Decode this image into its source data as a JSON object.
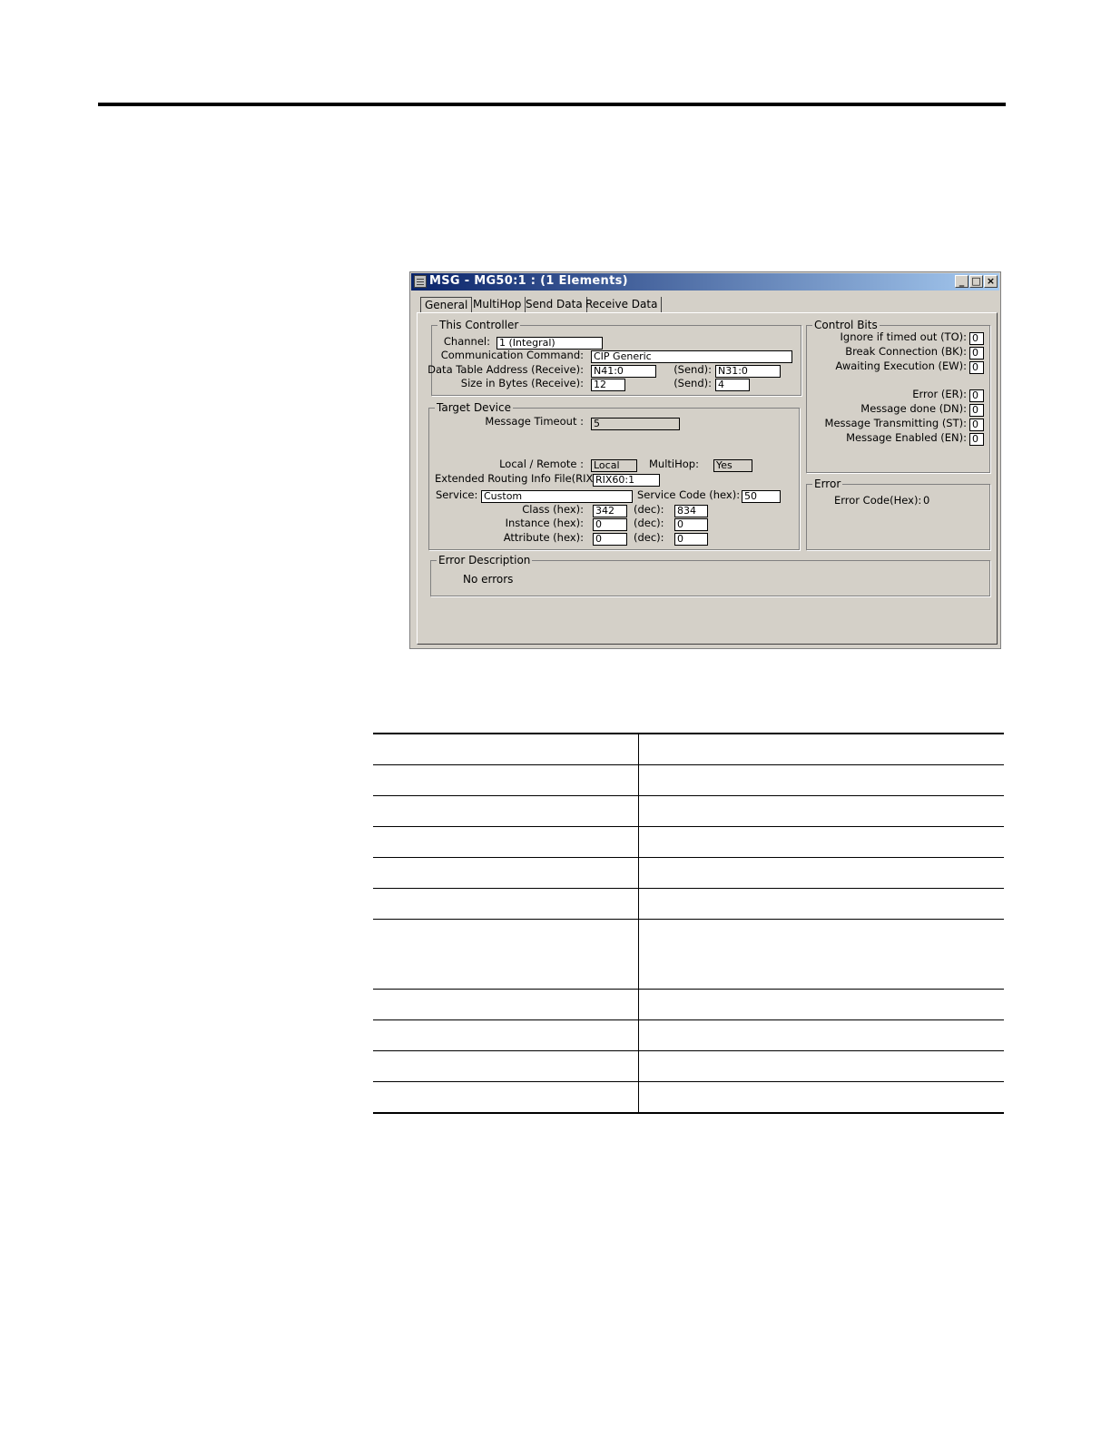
{
  "window": {
    "title": "MSG - MG50:1 : (1 Elements)",
    "min_glyph": "_",
    "max_glyph": "□",
    "close_glyph": "×"
  },
  "tabs": [
    {
      "label": "General",
      "active": true
    },
    {
      "label": "MultiHop",
      "active": false
    },
    {
      "label": "Send Data",
      "active": false
    },
    {
      "label": "Receive Data",
      "active": false
    }
  ],
  "this_controller": {
    "legend": "This Controller",
    "channel_label": "Channel:",
    "channel_value": "1 (Integral)",
    "command_label": "Communication Command:",
    "command_value": "CIP Generic",
    "dta_receive_label": "Data Table Address (Receive):",
    "dta_receive_value": "N41:0",
    "dta_send_label": "(Send):",
    "dta_send_value": "N31:0",
    "size_receive_label": "Size in Bytes (Receive):",
    "size_receive_value": "12",
    "size_send_label": "(Send):",
    "size_send_value": "4"
  },
  "target_device": {
    "legend": "Target Device",
    "timeout_label": "Message Timeout :",
    "timeout_value": "5",
    "local_remote_label": "Local / Remote :",
    "local_remote_value": "Local",
    "multihop_label": "MultiHop:",
    "multihop_value": "Yes",
    "rix_label": "Extended Routing Info File(RIX):",
    "rix_value": "RIX60:1",
    "service_label": "Service:",
    "service_value": "Custom",
    "service_code_label": "Service Code (hex):",
    "service_code_value": "50",
    "class_label": "Class (hex):",
    "class_hex": "342",
    "class_dec_label": "(dec):",
    "class_dec": "834",
    "instance_label": "Instance (hex):",
    "instance_hex": "0",
    "instance_dec_label": "(dec):",
    "instance_dec": "0",
    "attribute_label": "Attribute (hex):",
    "attribute_hex": "0",
    "attribute_dec_label": "(dec):",
    "attribute_dec": "0"
  },
  "control_bits": {
    "legend": "Control Bits",
    "items": [
      {
        "label": "Ignore if timed out (TO):",
        "value": "0"
      },
      {
        "label": "Break Connection (BK):",
        "value": "0"
      },
      {
        "label": "Awaiting Execution (EW):",
        "value": "0"
      },
      {
        "label": "Error (ER):",
        "value": "0"
      },
      {
        "label": "Message done (DN):",
        "value": "0"
      },
      {
        "label": "Message Transmitting (ST):",
        "value": "0"
      },
      {
        "label": "Message Enabled (EN):",
        "value": "0"
      }
    ]
  },
  "error": {
    "legend": "Error",
    "code_label": "Error Code(Hex):",
    "code_value": "0"
  },
  "error_description": {
    "legend": "Error Description",
    "text": "No errors"
  }
}
